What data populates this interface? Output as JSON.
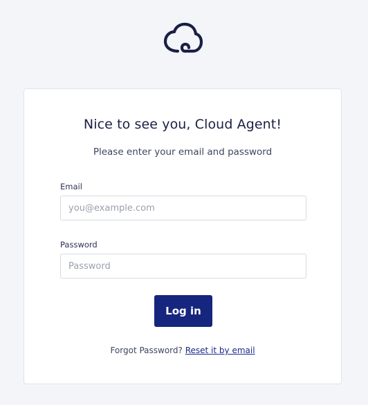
{
  "brand": {
    "logo_icon": "cloud-icon",
    "logo_color": "#1a1f44"
  },
  "login": {
    "title": "Nice to see you, Cloud Agent!",
    "subtitle": "Please enter your email and password",
    "email_label": "Email",
    "email_value": "",
    "email_placeholder": "you@example.com",
    "password_label": "Password",
    "password_value": "",
    "password_placeholder": "Password",
    "submit_label": "Log in",
    "submit_color": "#16257e",
    "forgot_text": "Forgot Password?",
    "reset_link": "Reset it by email"
  }
}
